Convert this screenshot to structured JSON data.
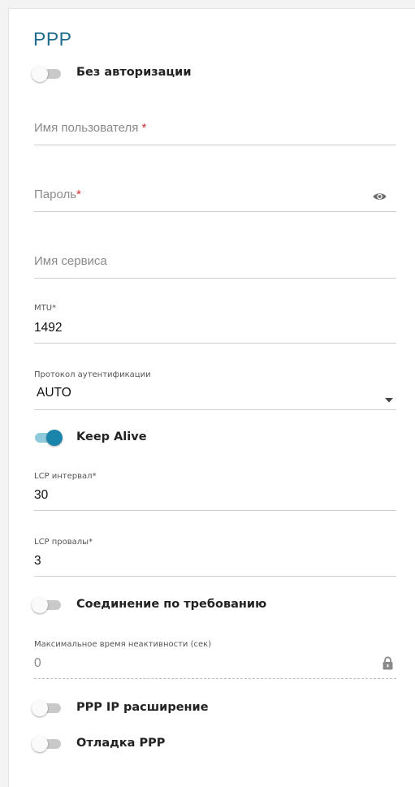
{
  "section_title": "PPP",
  "toggles": {
    "no_auth": {
      "label": "Без авторизации",
      "on": false
    },
    "keep_alive": {
      "label": "Keep Alive",
      "on": true
    },
    "on_demand": {
      "label": "Соединение по требованию",
      "on": false
    },
    "ppp_ip_ext": {
      "label": "PPP IP расширение",
      "on": false
    },
    "ppp_debug": {
      "label": "Отладка PPP",
      "on": false
    }
  },
  "fields": {
    "username": {
      "placeholder": "Имя пользователя",
      "required_mark": " *"
    },
    "password": {
      "placeholder": "Пароль",
      "required_mark": "*",
      "icon": "eye-icon"
    },
    "service_name": {
      "placeholder": "Имя сервиса"
    },
    "mtu": {
      "label": "MTU",
      "required_mark": "*",
      "value": "1492"
    },
    "auth_protocol": {
      "label": "Протокол аутентификации",
      "value": "AUTO",
      "icon": "dropdown-arrow-icon"
    },
    "lcp_interval": {
      "label": "LCP интервал",
      "required_mark": "*",
      "value": "30"
    },
    "lcp_failures": {
      "label": "LCP провалы",
      "required_mark": "*",
      "value": "3"
    },
    "max_idle": {
      "label": "Максимальное время неактивности (сек)",
      "value": "0",
      "icon": "lock-icon"
    }
  },
  "colors": {
    "accent": "#1a84aa",
    "title": "#1f6c8c",
    "required": "#d32f2f"
  }
}
